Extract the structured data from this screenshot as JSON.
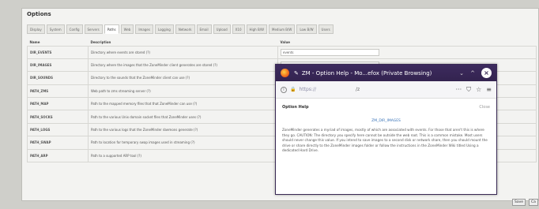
{
  "panel": {
    "title": "Options",
    "tabs": [
      "Display",
      "System",
      "Config",
      "Servers",
      "Paths",
      "Web",
      "Images",
      "Logging",
      "Network",
      "Email",
      "Upload",
      "X10",
      "High B/W",
      "Medium B/W",
      "Low B/W",
      "Users"
    ],
    "active_tab_index": 4,
    "columns": [
      "Name",
      "Description",
      "Value"
    ],
    "rows": [
      {
        "name": "DIR_EVENTS",
        "desc": "Directory where events are stored (?)",
        "value": "events"
      },
      {
        "name": "DIR_IMAGES",
        "desc": "Directory where the images that the ZoneMinder client generates are stored (?)",
        "value": ""
      },
      {
        "name": "DIR_SOUNDS",
        "desc": "Directory to the sounds that the ZoneMinder client can use (?)",
        "value": ""
      },
      {
        "name": "PATH_ZMS",
        "desc": "Web path to zms streaming server (?)",
        "value": ""
      },
      {
        "name": "PATH_MAP",
        "desc": "Path to the mapped memory files that that ZoneMinder can use (?)",
        "value": ""
      },
      {
        "name": "PATH_SOCKS",
        "desc": "Path to the various Unix domain socket files that ZoneMinder uses (?)",
        "value": ""
      },
      {
        "name": "PATH_LOGS",
        "desc": "Path to the various logs that the ZoneMinder daemons generate (?)",
        "value": ""
      },
      {
        "name": "PATH_SWAP",
        "desc": "Path to location for temporary swap images used in streaming (?)",
        "value": ""
      },
      {
        "name": "PATH_ARP",
        "desc": "Path to a supported ARP tool (?)",
        "value": ""
      }
    ],
    "save_label": "Save",
    "cancel_label": "Ca"
  },
  "popup": {
    "title": "ZM - Option Help - Mo...efox (Private Browsing)",
    "url": "https://",
    "url_mid": "/z",
    "heading": "Option Help",
    "close_label": "Close",
    "option_name": "ZM_DIR_IMAGES",
    "help_text": "ZoneMinder generates a myriad of images, mostly of which are associated with events. For those that aren't this is where they go. CAUTION: The directory you specify here cannot be outside the web root. This is a common mistake. Most users should never change this value. If you intend to save images to a second disk or network share, then you should mount the drive or share directly to the ZoneMinder images folder or follow the instructions in the ZoneMinder Wiki titled Using a dedicated Hard Drive.",
    "colors": {
      "titlebar": "#3d2b5e",
      "link": "#3b74b8"
    }
  }
}
